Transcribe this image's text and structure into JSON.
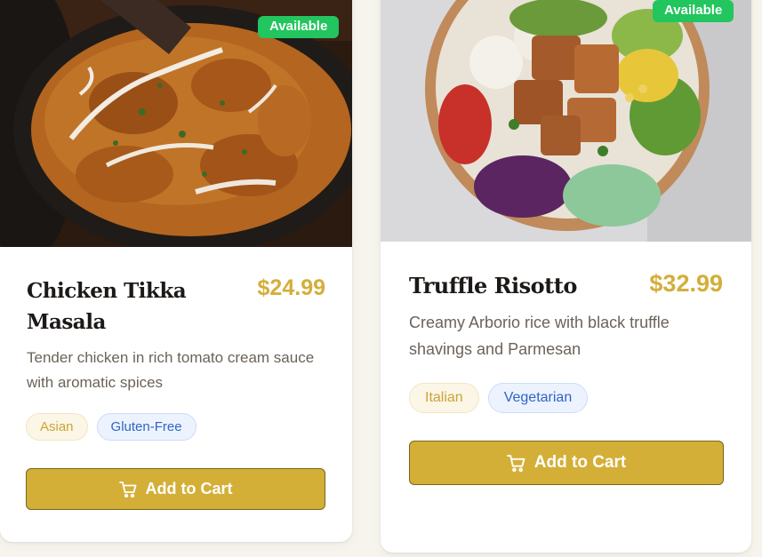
{
  "cards": [
    {
      "badge": "Available",
      "title": "Chicken Tikka Masala",
      "price": "$24.99",
      "description": "Tender chicken in rich tomato cream sauce with aromatic spices",
      "tags": [
        "Asian",
        "Gluten-Free"
      ],
      "button_label": "Add to Cart",
      "icon": "shopping-cart-icon"
    },
    {
      "badge": "Available",
      "title": "Truffle Risotto",
      "price": "$32.99",
      "description": "Creamy Arborio rice with black truffle shavings and Parmesan",
      "tags": [
        "Italian",
        "Vegetarian"
      ],
      "button_label": "Add to Cart",
      "icon": "shopping-cart-icon"
    }
  ],
  "colors": {
    "price": "#d4ae3a",
    "button": "#d4af37",
    "badge": "#22c55e",
    "tag_cuisine": "#caa43a",
    "tag_diet": "#2f64c4"
  }
}
